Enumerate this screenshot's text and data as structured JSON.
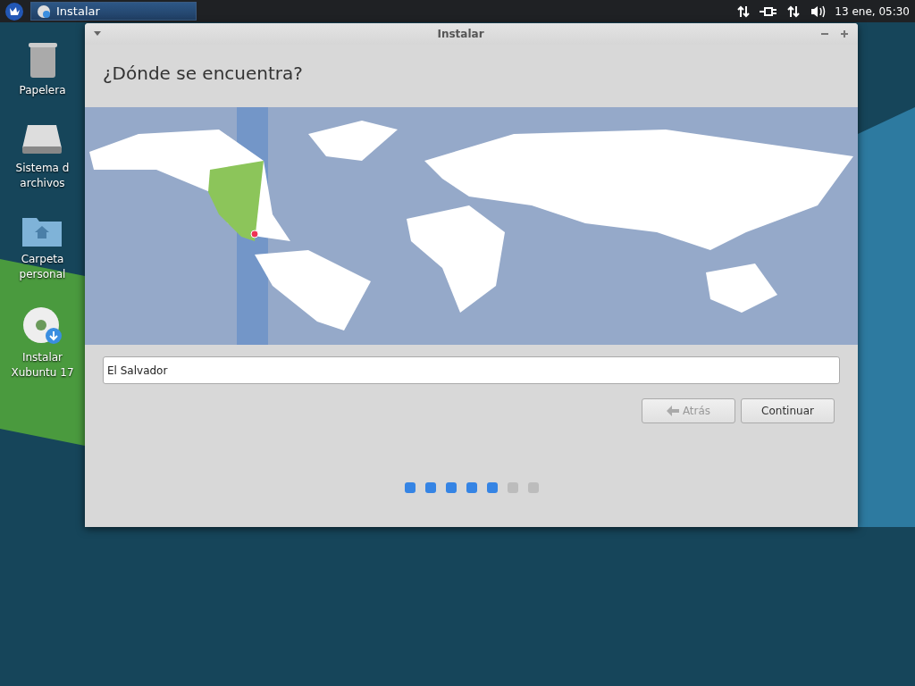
{
  "panel": {
    "task": {
      "label": "Instalar",
      "selected": true
    },
    "clock": "13 ene, 05:30"
  },
  "desktop_icons": [
    {
      "kind": "trash",
      "lines": [
        "Papelera"
      ]
    },
    {
      "kind": "drive",
      "lines": [
        "Sistema d",
        "archivos"
      ]
    },
    {
      "kind": "home",
      "lines": [
        "Carpeta",
        "personal"
      ]
    },
    {
      "kind": "installer",
      "lines": [
        "Instalar",
        "Xubuntu 17"
      ]
    }
  ],
  "window": {
    "title": "Instalar",
    "heading": "¿Dónde se encuentra?",
    "location": {
      "value": "El Salvador"
    },
    "buttons": [
      {
        "label": "Atrás",
        "disabled": true,
        "kind": "back"
      },
      {
        "label": "Continuar",
        "disabled": false,
        "kind": "next"
      }
    ],
    "steps": [
      {
        "completed": true
      },
      {
        "completed": true
      },
      {
        "completed": true
      },
      {
        "completed": true
      },
      {
        "completed": true
      },
      {
        "completed": false
      },
      {
        "completed": false
      }
    ]
  }
}
